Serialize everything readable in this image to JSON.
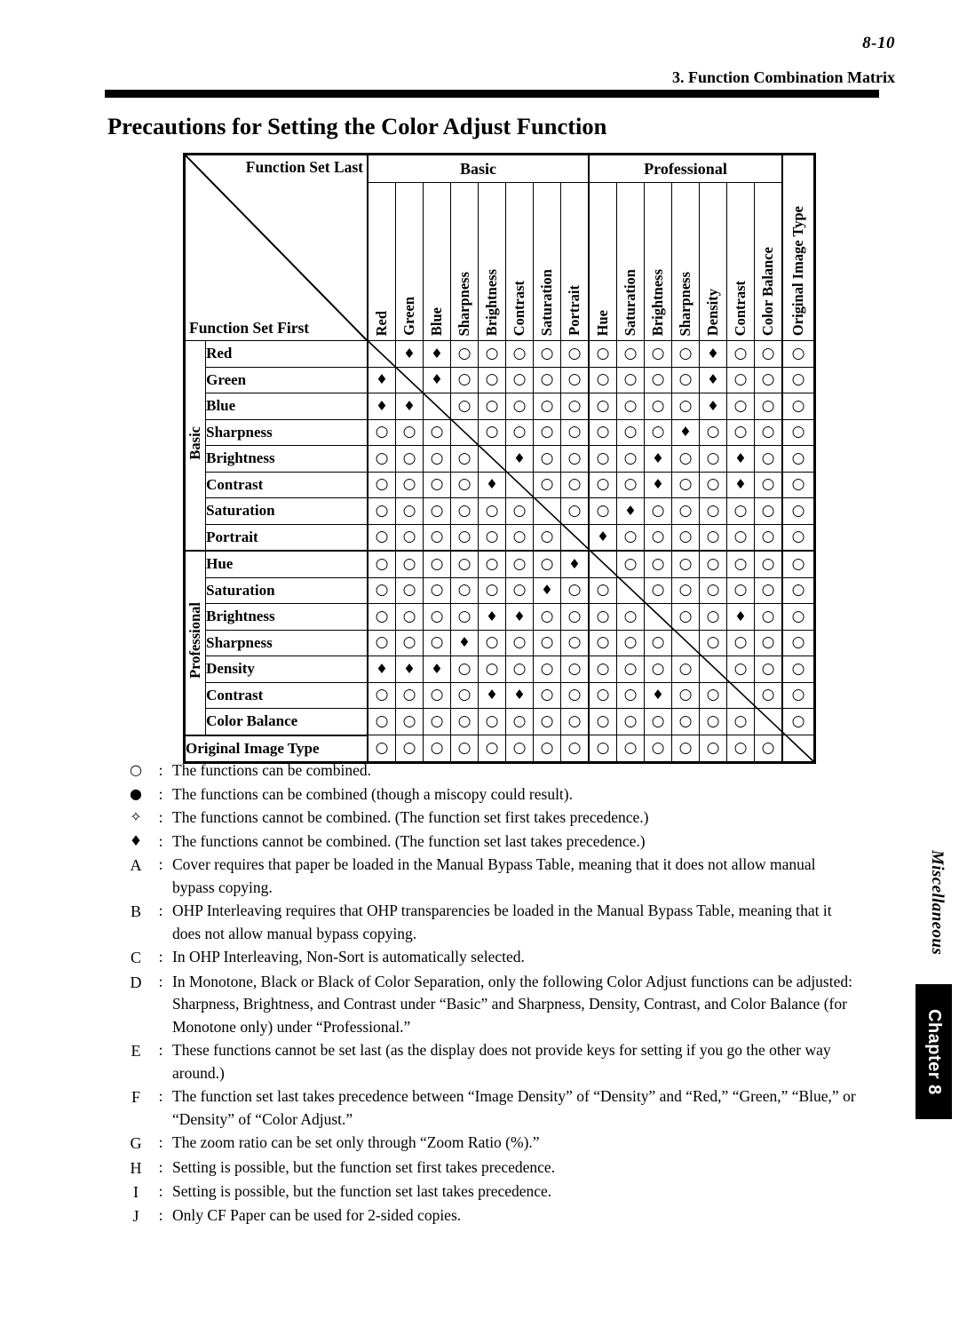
{
  "header": {
    "page_number": "8-10",
    "section": "3. Function Combination Matrix",
    "title": "Precautions for Setting the Color Adjust Function"
  },
  "matrix": {
    "corner_last_label": "Function Set Last",
    "corner_first_label": "Function Set First",
    "group_headers": [
      {
        "label": "Basic",
        "span": 8
      },
      {
        "label": "Professional",
        "span": 7
      }
    ],
    "columns": [
      "Red",
      "Green",
      "Blue",
      "Sharpness",
      "Brightness",
      "Contrast",
      "Saturation",
      "Portrait",
      "Hue",
      "Saturation",
      "Brightness",
      "Sharpness",
      "Density",
      "Contrast",
      "Color Balance",
      "Original Image Type"
    ],
    "side_groups": [
      {
        "label": "Basic",
        "rows": 8
      },
      {
        "label": "Professional",
        "rows": 7
      }
    ],
    "rows": [
      {
        "label": "Red",
        "group": "Basic",
        "cells": [
          "X",
          "d",
          "d",
          "o",
          "o",
          "o",
          "o",
          "o",
          "o",
          "o",
          "o",
          "o",
          "d",
          "o",
          "o",
          "o"
        ]
      },
      {
        "label": "Green",
        "group": "Basic",
        "cells": [
          "d",
          "X",
          "d",
          "o",
          "o",
          "o",
          "o",
          "o",
          "o",
          "o",
          "o",
          "o",
          "d",
          "o",
          "o",
          "o"
        ]
      },
      {
        "label": "Blue",
        "group": "Basic",
        "cells": [
          "d",
          "d",
          "X",
          "o",
          "o",
          "o",
          "o",
          "o",
          "o",
          "o",
          "o",
          "o",
          "d",
          "o",
          "o",
          "o"
        ]
      },
      {
        "label": "Sharpness",
        "group": "Basic",
        "cells": [
          "o",
          "o",
          "o",
          "X",
          "o",
          "o",
          "o",
          "o",
          "o",
          "o",
          "o",
          "d",
          "o",
          "o",
          "o",
          "o"
        ]
      },
      {
        "label": "Brightness",
        "group": "Basic",
        "cells": [
          "o",
          "o",
          "o",
          "o",
          "X",
          "d",
          "o",
          "o",
          "o",
          "o",
          "d",
          "o",
          "o",
          "d",
          "o",
          "o"
        ]
      },
      {
        "label": "Contrast",
        "group": "Basic",
        "cells": [
          "o",
          "o",
          "o",
          "o",
          "d",
          "X",
          "o",
          "o",
          "o",
          "o",
          "d",
          "o",
          "o",
          "d",
          "o",
          "o"
        ]
      },
      {
        "label": "Saturation",
        "group": "Basic",
        "cells": [
          "o",
          "o",
          "o",
          "o",
          "o",
          "o",
          "X",
          "o",
          "o",
          "d",
          "o",
          "o",
          "o",
          "o",
          "o",
          "o"
        ]
      },
      {
        "label": "Portrait",
        "group": "Basic",
        "cells": [
          "o",
          "o",
          "o",
          "o",
          "o",
          "o",
          "o",
          "X",
          "d",
          "o",
          "o",
          "o",
          "o",
          "o",
          "o",
          "o"
        ]
      },
      {
        "label": "Hue",
        "group": "Professional",
        "cells": [
          "o",
          "o",
          "o",
          "o",
          "o",
          "o",
          "o",
          "d",
          "X",
          "o",
          "o",
          "o",
          "o",
          "o",
          "o",
          "o"
        ]
      },
      {
        "label": "Saturation",
        "group": "Professional",
        "cells": [
          "o",
          "o",
          "o",
          "o",
          "o",
          "o",
          "d",
          "o",
          "o",
          "X",
          "o",
          "o",
          "o",
          "o",
          "o",
          "o"
        ]
      },
      {
        "label": "Brightness",
        "group": "Professional",
        "cells": [
          "o",
          "o",
          "o",
          "o",
          "d",
          "d",
          "o",
          "o",
          "o",
          "o",
          "X",
          "o",
          "o",
          "d",
          "o",
          "o"
        ]
      },
      {
        "label": "Sharpness",
        "group": "Professional",
        "cells": [
          "o",
          "o",
          "o",
          "d",
          "o",
          "o",
          "o",
          "o",
          "o",
          "o",
          "o",
          "X",
          "o",
          "o",
          "o",
          "o"
        ]
      },
      {
        "label": "Density",
        "group": "Professional",
        "cells": [
          "d",
          "d",
          "d",
          "o",
          "o",
          "o",
          "o",
          "o",
          "o",
          "o",
          "o",
          "o",
          "X",
          "o",
          "o",
          "o"
        ]
      },
      {
        "label": "Contrast",
        "group": "Professional",
        "cells": [
          "o",
          "o",
          "o",
          "o",
          "d",
          "d",
          "o",
          "o",
          "o",
          "o",
          "d",
          "o",
          "o",
          "X",
          "o",
          "o"
        ]
      },
      {
        "label": "Color Balance",
        "group": "Professional",
        "cells": [
          "o",
          "o",
          "o",
          "o",
          "o",
          "o",
          "o",
          "o",
          "o",
          "o",
          "o",
          "o",
          "o",
          "o",
          "X",
          "o"
        ]
      },
      {
        "label": "Original Image Type",
        "group": "",
        "cells": [
          "o",
          "o",
          "o",
          "o",
          "o",
          "o",
          "o",
          "o",
          "o",
          "o",
          "o",
          "o",
          "o",
          "o",
          "o",
          "X"
        ]
      }
    ],
    "symbols": {
      "o": "○",
      "d": "♦",
      "X": ""
    }
  },
  "legend": [
    {
      "key": "○",
      "type": "symbol",
      "text": "The functions can be combined."
    },
    {
      "key": "●",
      "type": "symbol",
      "text": "The functions can be combined (though a miscopy could result)."
    },
    {
      "key": "✧",
      "type": "symbol",
      "text": "The functions cannot be combined. (The function set first takes precedence.)"
    },
    {
      "key": "♦",
      "type": "symbol",
      "text": "The functions cannot be combined. (The function set last takes precedence.)"
    },
    {
      "key": "A",
      "type": "alpha",
      "text": "Cover requires that paper be loaded in the Manual Bypass Table, meaning that it does not allow manual bypass copying."
    },
    {
      "key": "B",
      "type": "alpha",
      "text": "OHP Interleaving requires that OHP transparencies be loaded in the Manual Bypass Table, meaning that it does not allow manual bypass copying."
    },
    {
      "key": "C",
      "type": "alpha",
      "text": "In OHP Interleaving, Non-Sort is automatically selected."
    },
    {
      "key": "D",
      "type": "alpha",
      "text": "In Monotone, Black or Black of Color Separation, only the following Color Adjust functions can be adjusted: Sharpness, Brightness, and Contrast under “Basic” and Sharpness, Density, Contrast, and Color Balance (for Monotone only) under “Professional.”"
    },
    {
      "key": "E",
      "type": "alpha",
      "text": "These functions cannot be set last (as the display does not provide keys for setting if you go the other way around.)"
    },
    {
      "key": "F",
      "type": "alpha",
      "text": "The function set last takes precedence between “Image Density” of “Density” and “Red,” “Green,” “Blue,” or “Density” of “Color Adjust.”"
    },
    {
      "key": "G",
      "type": "alpha",
      "text": "The zoom ratio can be set only through “Zoom Ratio (%).”"
    },
    {
      "key": "H",
      "type": "alpha",
      "text": "Setting is possible, but the function set first takes precedence."
    },
    {
      "key": "I",
      "type": "alpha",
      "text": "Setting is possible, but the function set last takes precedence."
    },
    {
      "key": "J",
      "type": "alpha",
      "text": "Only CF Paper can be used for 2-sided copies."
    }
  ],
  "side_tabs": {
    "miscellaneous": "Miscellaneous",
    "chapter": "Chapter 8"
  }
}
